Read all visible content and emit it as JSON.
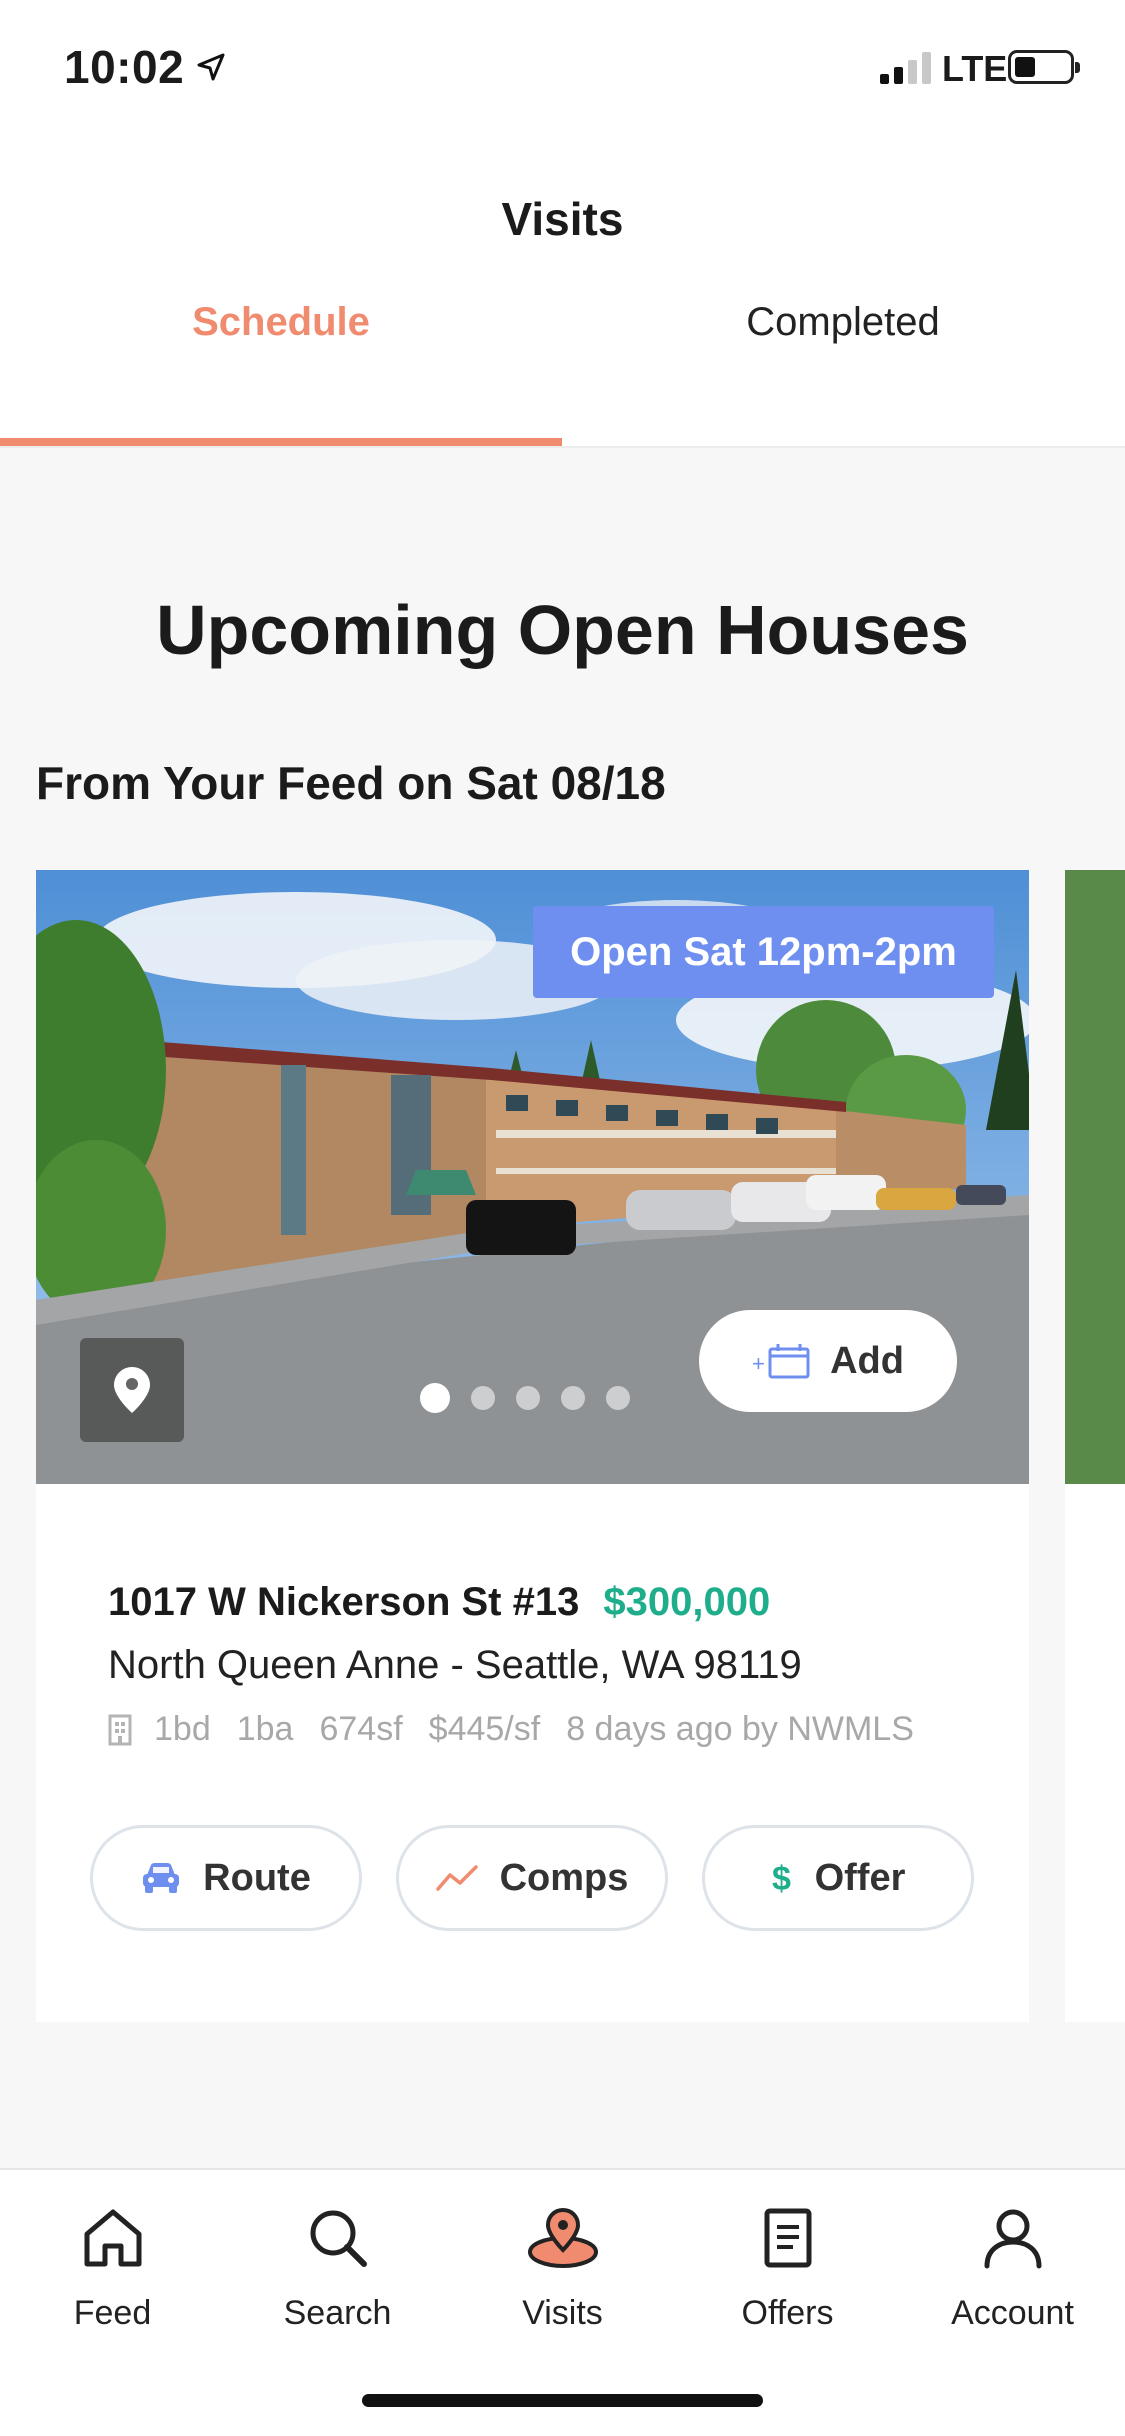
{
  "status_bar": {
    "time": "10:02",
    "network": "LTE"
  },
  "header": {
    "title": "Visits",
    "tabs": [
      {
        "label": "Schedule",
        "active": true
      },
      {
        "label": "Completed",
        "active": false
      }
    ]
  },
  "main": {
    "heading": "Upcoming Open Houses",
    "subheading": "From Your Feed on Sat 08/18",
    "listing": {
      "open_house_badge": "Open Sat 12pm-2pm",
      "add_label": "Add",
      "photo_count": 5,
      "active_photo": 1,
      "address": "1017 W Nickerson St #13",
      "price": "$300,000",
      "locality": "North Queen Anne - Seattle, WA 98119",
      "beds": "1bd",
      "baths": "1ba",
      "sqft": "674sf",
      "price_per_sqft": "$445/sf",
      "listed": "8 days ago by NWMLS",
      "actions": [
        {
          "label": "Route",
          "icon": "car-icon"
        },
        {
          "label": "Comps",
          "icon": "trend-icon"
        },
        {
          "label": "Offer",
          "icon": "dollar-icon"
        }
      ]
    }
  },
  "tabbar": {
    "items": [
      {
        "label": "Feed",
        "icon": "home-icon"
      },
      {
        "label": "Search",
        "icon": "search-icon"
      },
      {
        "label": "Visits",
        "icon": "visits-pin-icon",
        "active": true
      },
      {
        "label": "Offers",
        "icon": "document-icon"
      },
      {
        "label": "Account",
        "icon": "person-icon"
      }
    ]
  },
  "colors": {
    "accent": "#f08b6f",
    "badge": "#6f8ff0",
    "price": "#1fae8c"
  }
}
